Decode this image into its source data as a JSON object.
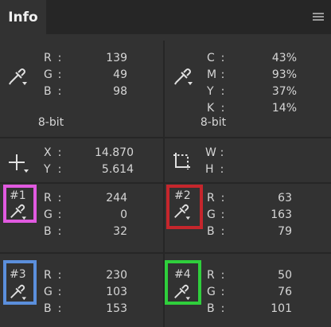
{
  "header": {
    "tab_label": "Info",
    "menu_icon": "panel-menu-icon"
  },
  "rgb": {
    "icon": "eyedropper-icon",
    "labels": [
      "R",
      "G",
      "B"
    ],
    "values": [
      "139",
      "49",
      "98"
    ],
    "bit_depth": "8-bit"
  },
  "cmyk": {
    "icon": "eyedropper-icon",
    "labels": [
      "C",
      "M",
      "Y",
      "K"
    ],
    "values": [
      "43%",
      "93%",
      "37%",
      "14%"
    ],
    "bit_depth": "8-bit"
  },
  "position": {
    "icon": "crosshair-icon",
    "labels": [
      "X",
      "Y"
    ],
    "values": [
      "14.870",
      "5.614"
    ]
  },
  "size": {
    "icon": "selection-bounds-icon",
    "labels": [
      "W",
      "H"
    ],
    "values": [
      "",
      ""
    ]
  },
  "colon": ":",
  "samplers": [
    {
      "label": "#1",
      "labels": [
        "R",
        "G",
        "B"
      ],
      "values": [
        "244",
        "0",
        "32"
      ],
      "highlight": "#e15ae0"
    },
    {
      "label": "#2",
      "labels": [
        "R",
        "G",
        "B"
      ],
      "values": [
        "63",
        "163",
        "79"
      ],
      "highlight": "#c5262c"
    },
    {
      "label": "#3",
      "labels": [
        "R",
        "G",
        "B"
      ],
      "values": [
        "230",
        "103",
        "153"
      ],
      "highlight": "#5b8fdc"
    },
    {
      "label": "#4",
      "labels": [
        "R",
        "G",
        "B"
      ],
      "values": [
        "50",
        "76",
        "101"
      ],
      "highlight": "#2fcf3c"
    }
  ]
}
